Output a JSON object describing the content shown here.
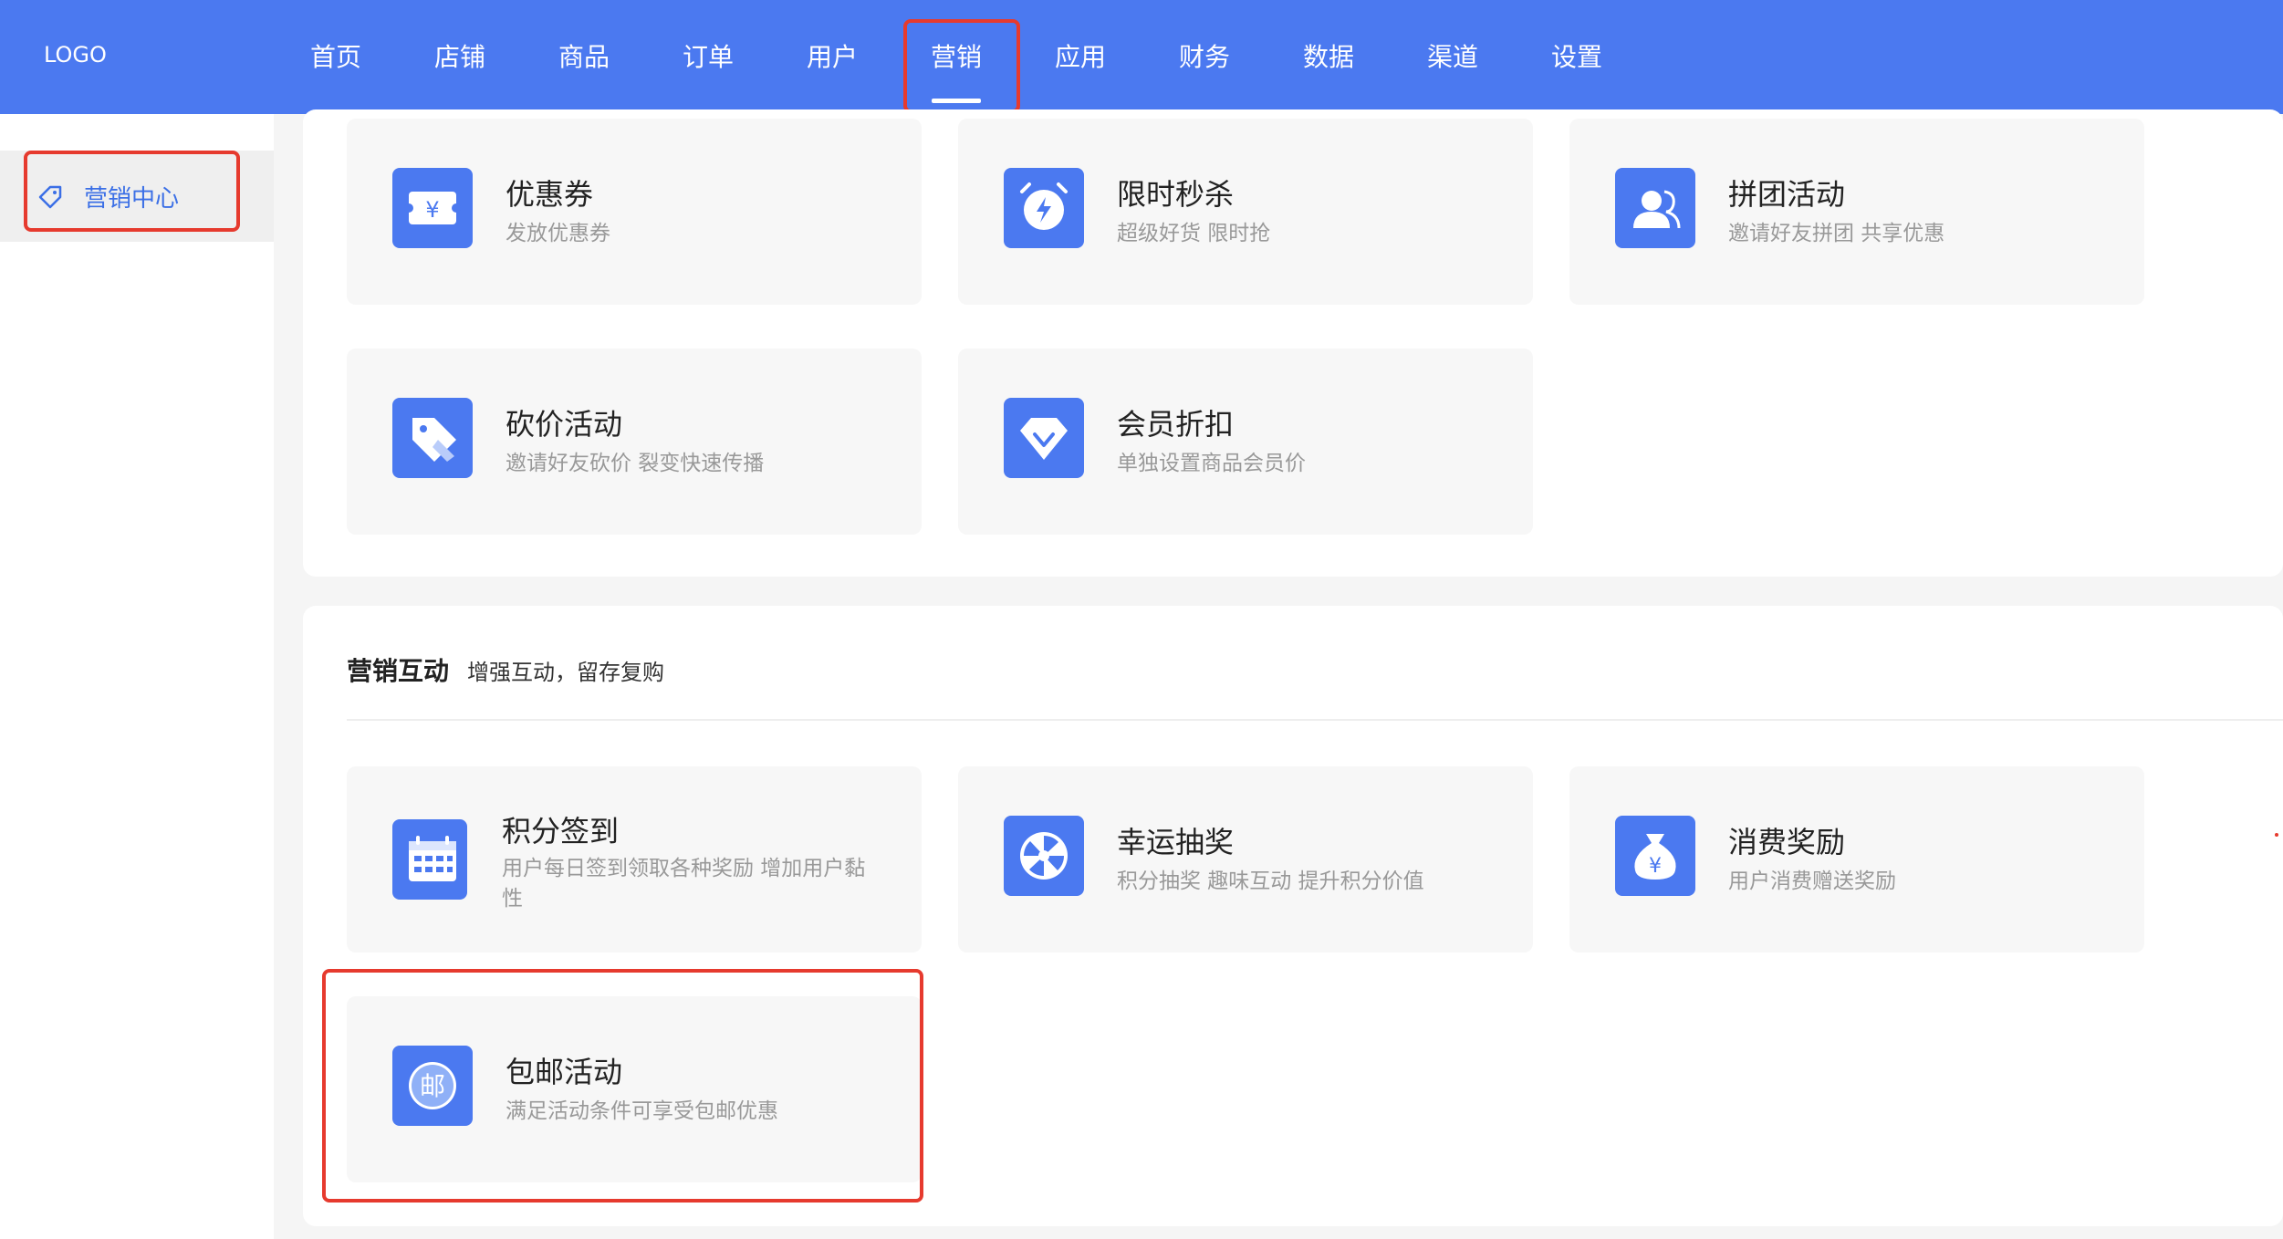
{
  "logo": "LOGO",
  "nav": {
    "items": [
      "首页",
      "店铺",
      "商品",
      "订单",
      "用户",
      "营销",
      "应用",
      "财务",
      "数据",
      "渠道",
      "设置"
    ],
    "active": "营销"
  },
  "sidebar": {
    "items": [
      {
        "label": "营销中心"
      }
    ]
  },
  "promo_cards": [
    {
      "title": "优惠券",
      "desc": "发放优惠券",
      "icon": "coupon-icon"
    },
    {
      "title": "限时秒杀",
      "desc": "超级好货 限时抢",
      "icon": "alarm-clock-icon"
    },
    {
      "title": "拼团活动",
      "desc": "邀请好友拼团 共享优惠",
      "icon": "group-users-icon"
    },
    {
      "title": "砍价活动",
      "desc": "邀请好友砍价 裂变快速传播",
      "icon": "price-tag-icon"
    },
    {
      "title": "会员折扣",
      "desc": "单独设置商品会员价",
      "icon": "diamond-icon"
    }
  ],
  "interaction_section": {
    "title": "营销互动",
    "subtitle": "增强互动，留存复购",
    "cards": [
      {
        "title": "积分签到",
        "desc": "用户每日签到领取各种奖励 增加用户黏性",
        "icon": "calendar-icon"
      },
      {
        "title": "幸运抽奖",
        "desc": "积分抽奖 趣味互动 提升积分价值",
        "icon": "lucky-wheel-icon"
      },
      {
        "title": "消费奖励",
        "desc": "用户消费赠送奖励",
        "icon": "money-bag-icon"
      },
      {
        "title": "包邮活动",
        "desc": "满足活动条件可享受包邮优惠",
        "icon": "mail-stamp-icon",
        "icon_text": "邮"
      }
    ]
  },
  "colors": {
    "accent": "#4b79f0",
    "highlight": "#e63a2e"
  }
}
